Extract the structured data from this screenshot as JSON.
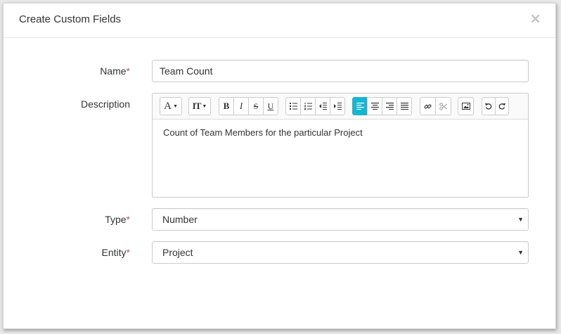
{
  "modal": {
    "title": "Create Custom Fields",
    "close_glyph": "×"
  },
  "form": {
    "name": {
      "label": "Name",
      "required_mark": "*",
      "value": "Team Count"
    },
    "description": {
      "label": "Description",
      "value": "Count of Team Members for the particular Project"
    },
    "type": {
      "label": "Type",
      "required_mark": "*",
      "selected": "Number"
    },
    "entity": {
      "label": "Entity",
      "required_mark": "*",
      "selected": "Project"
    }
  },
  "toolbar": {
    "font_glyph": "A",
    "size_glyph": "IT",
    "bold_glyph": "B",
    "italic_glyph": "I",
    "strike_glyph": "S",
    "underline_glyph": "U"
  },
  "icons": {
    "caret": "▼",
    "select_caret": "▼"
  },
  "colors": {
    "accent": "#16b5d4",
    "required": "#d9534f"
  }
}
